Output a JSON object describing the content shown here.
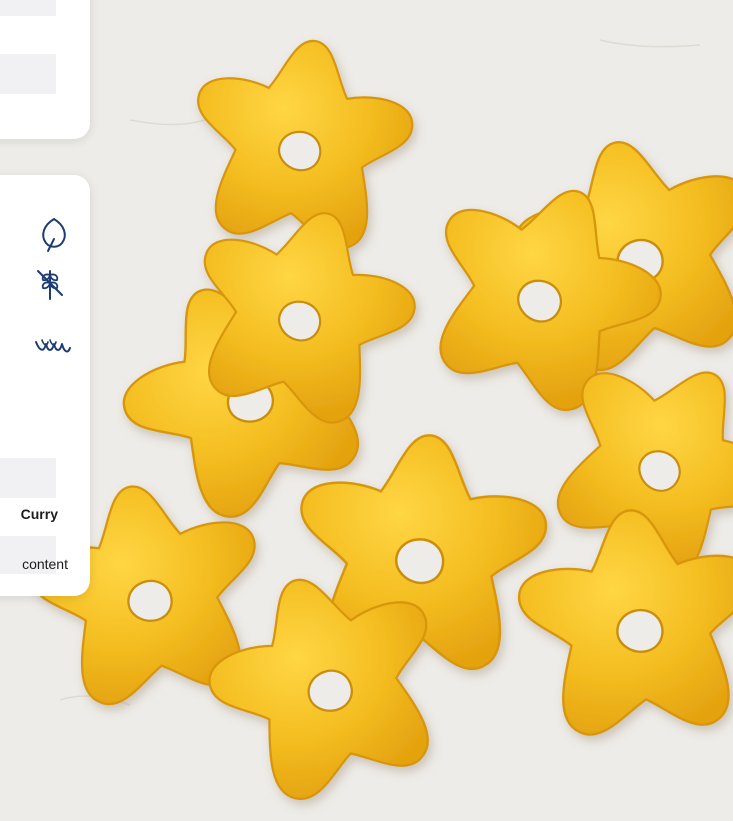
{
  "product": {
    "flavor_label": "Curry",
    "content_label": "content"
  },
  "icons": [
    "leaf-icon",
    "wheat-icon",
    "lentil-icon"
  ],
  "colors": {
    "card_background": "#ffffff",
    "row_background": "#f1f1f3",
    "icon_stroke": "#1d3c73",
    "snack_yellow": "#f2bb1f"
  }
}
